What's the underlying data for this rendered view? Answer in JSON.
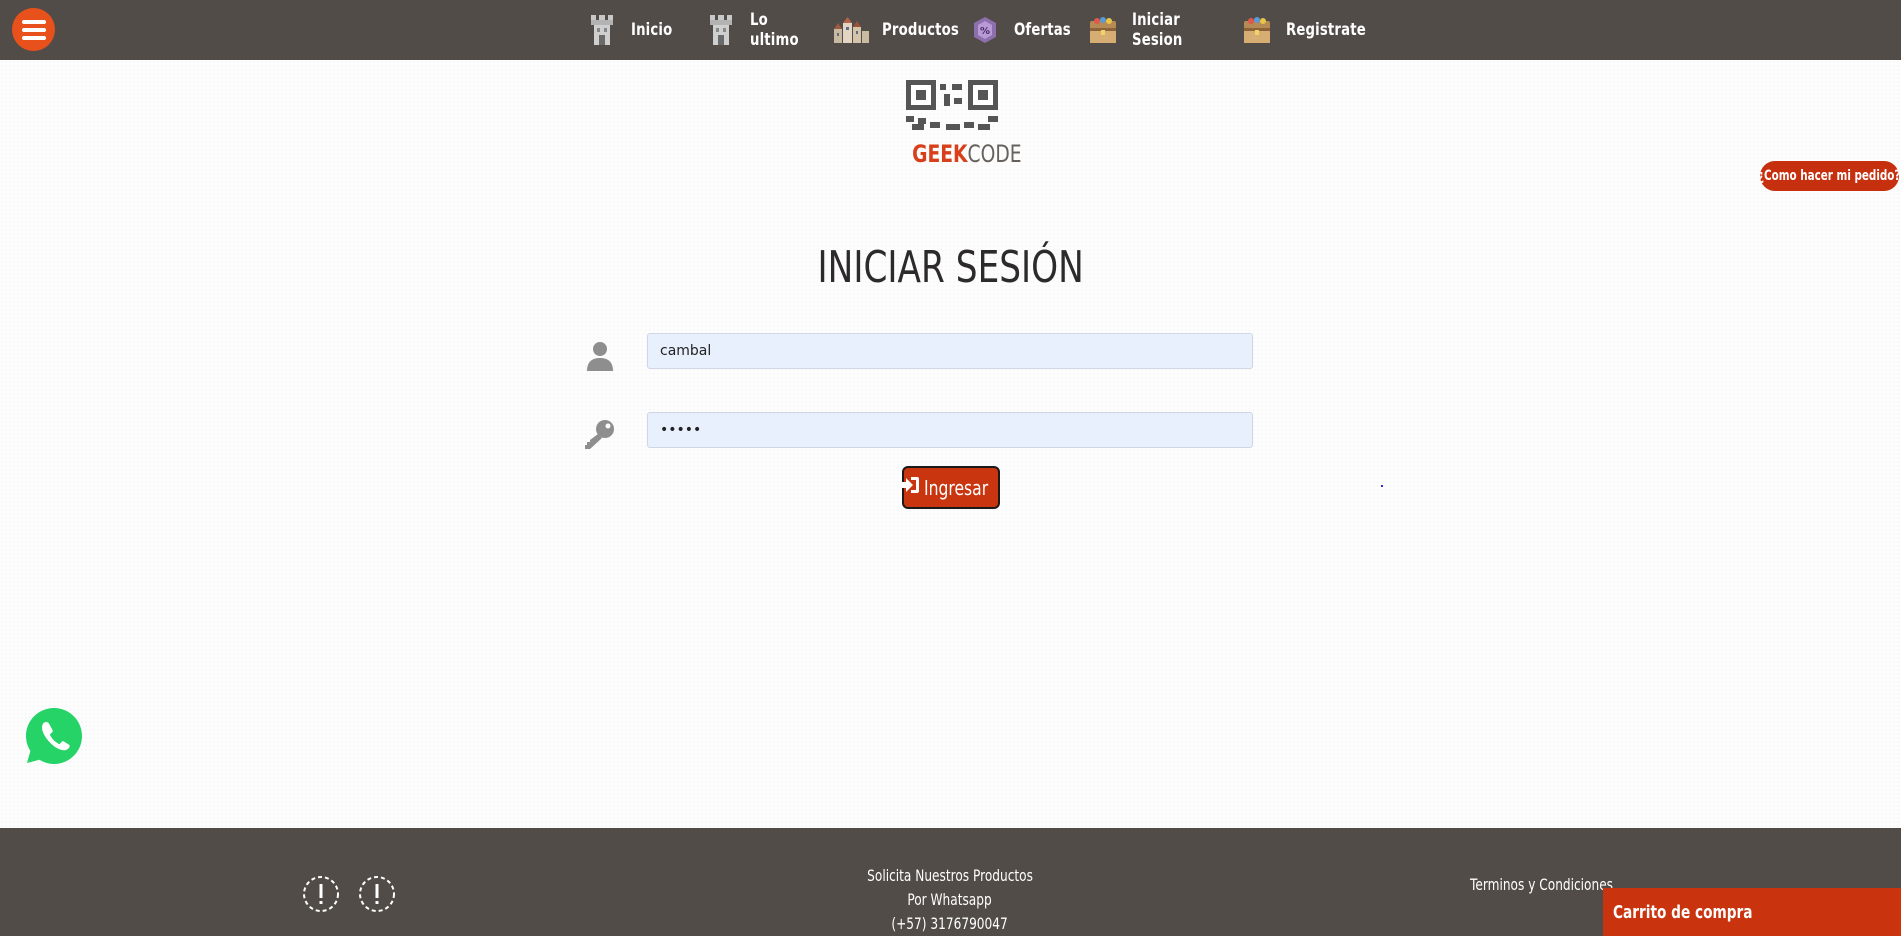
{
  "header": {
    "menu_icon": "hamburger-menu-icon",
    "nav": [
      {
        "label": "Inicio",
        "icon": "castle-tower-icon"
      },
      {
        "label": "Lo ultimo",
        "icon": "castle-tower-icon"
      },
      {
        "label": "Productos",
        "icon": "town-buildings-icon"
      },
      {
        "label": "Ofertas",
        "icon": "potion-gem-icon"
      },
      {
        "label": "Iniciar Sesion",
        "icon": "treasure-chest-icon"
      },
      {
        "label": "Registrate",
        "icon": "treasure-chest-icon"
      }
    ]
  },
  "brand": {
    "geek": "GEEK",
    "code": "CODE"
  },
  "help": {
    "label": "¿Como hacer mi pedido?"
  },
  "login": {
    "title": "INICIAR SESIÓN",
    "username_value": "cambal",
    "password_value": "•••••",
    "submit_label": "Ingresar"
  },
  "footer": {
    "line1": "Solicita Nuestros Productos",
    "line2": "Por Whatsapp",
    "line3": "(+57) 3176790047",
    "terms": "Terminos y Condiciones",
    "cart": "Carrito de compra"
  },
  "colors": {
    "bar": "#514c47",
    "accent": "#c9330d",
    "menu_button": "#e8501c",
    "input_bg": "#e8f0fe"
  }
}
